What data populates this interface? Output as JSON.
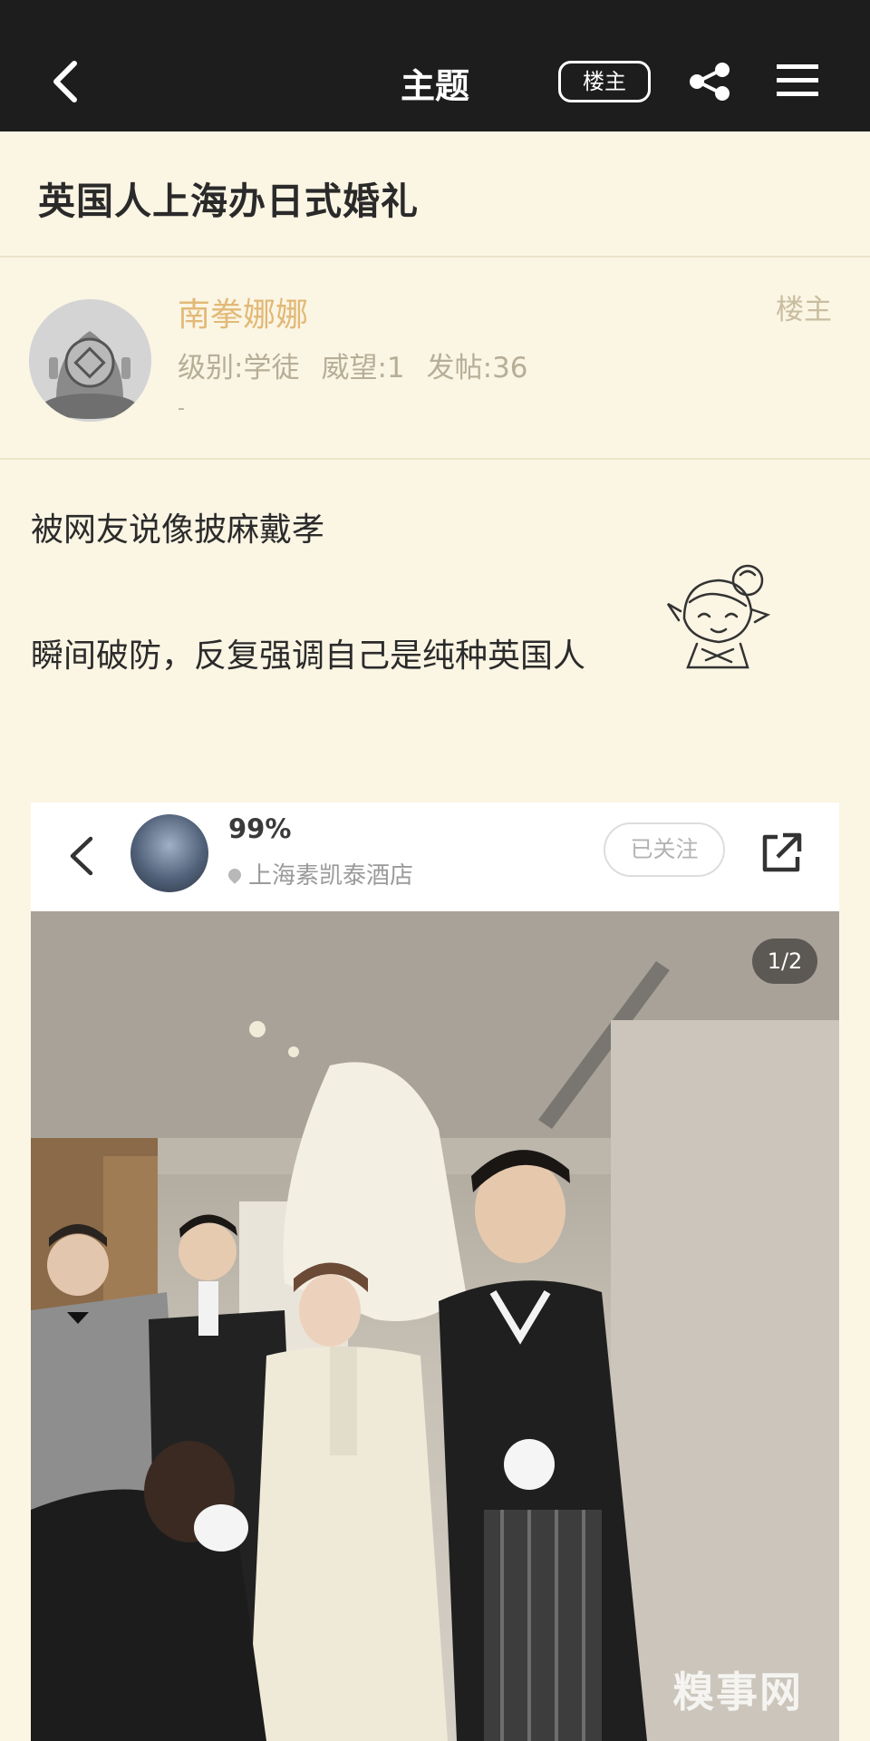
{
  "nav": {
    "title": "主题",
    "op_badge": "楼主"
  },
  "thread": {
    "title": "英国人上海办日式婚礼"
  },
  "author": {
    "name": "南拳娜娜",
    "level": "级别:学徒",
    "prestige": "威望:1",
    "posts": "发帖:36",
    "signature": "-",
    "op_tag": "楼主"
  },
  "post": {
    "line1": "被网友说像披麻戴孝",
    "line2": "瞬间破防，反复强调自己是纯种英国人"
  },
  "embed": {
    "username": "99%",
    "location": "上海素凯泰酒店",
    "follow_label": "已关注",
    "counter": "1/2",
    "watermark": "糗事网"
  },
  "colors": {
    "topbar": "#1d1d1d",
    "page_bg": "#fbf5e4",
    "author_name": "#e2b977",
    "meta_text": "#b7ae97"
  },
  "icons": [
    "back-arrow-icon",
    "share-icon",
    "menu-icon",
    "diving-helmet-avatar",
    "sticker-icon",
    "location-pin-icon",
    "external-share-icon"
  ]
}
